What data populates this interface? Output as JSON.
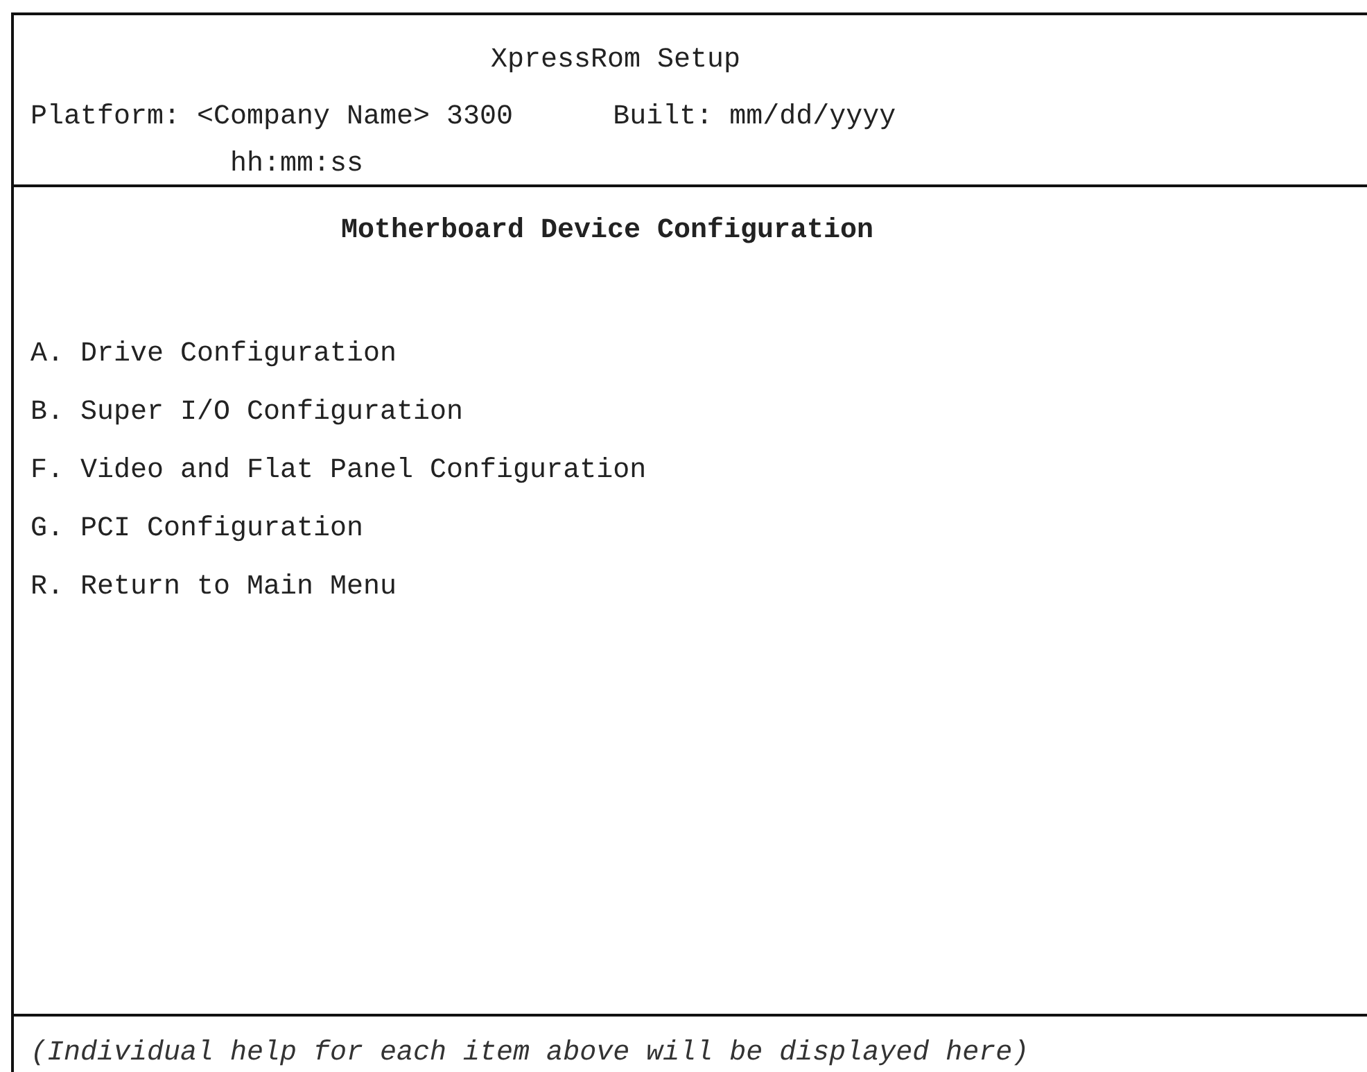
{
  "header": {
    "title": "XpressRom Setup",
    "platform": "Platform: <Company Name> 3300",
    "built_date": "Built: mm/dd/yyyy",
    "built_time": "hh:mm:ss"
  },
  "menu": {
    "heading": "Motherboard Device Configuration",
    "items": [
      {
        "label": "A. Drive Configuration"
      },
      {
        "label": "B. Super I/O Configuration"
      },
      {
        "label": "F. Video and Flat Panel Configuration"
      },
      {
        "label": "G. PCI Configuration"
      },
      {
        "label": "R. Return to Main Menu"
      }
    ]
  },
  "help": "(Individual help for each item above will be displayed here)"
}
